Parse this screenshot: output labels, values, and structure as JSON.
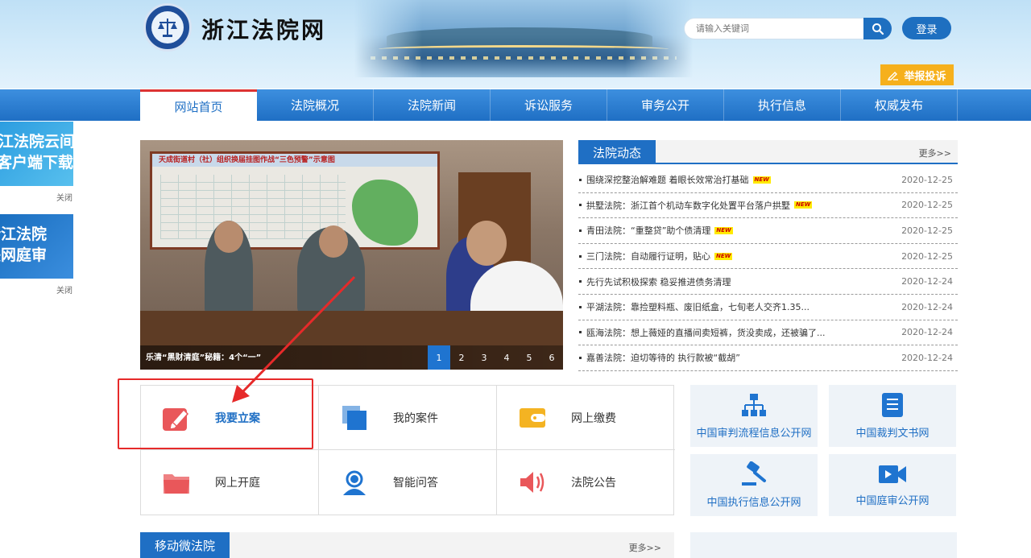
{
  "header": {
    "site_name": "浙江法院网",
    "search_placeholder": "请输入关键词",
    "login_label": "登录",
    "report_label": "举报投诉"
  },
  "nav": {
    "items": [
      {
        "label": "网站首页",
        "active": true
      },
      {
        "label": "法院概况"
      },
      {
        "label": "法院新闻"
      },
      {
        "label": "诉讼服务"
      },
      {
        "label": "审务公开"
      },
      {
        "label": "执行信息"
      },
      {
        "label": "权威发布"
      }
    ]
  },
  "side_ads": [
    {
      "line1": "江法院云间",
      "line2": "客户端下载",
      "close": "关闭"
    },
    {
      "line1": "浙江法院",
      "line2": "联网庭审",
      "close": "关闭"
    }
  ],
  "carousel": {
    "caption": "乐清“黑财清庭”秘籍：4个“一”",
    "board_title": "天成街道村（社）组织换届挂图作战“三色预警”示意图",
    "pages": [
      "1",
      "2",
      "3",
      "4",
      "5",
      "6"
    ],
    "active_page": 1
  },
  "news": {
    "title": "法院动态",
    "more": "更多>>",
    "new_badge": "NEW",
    "items": [
      {
        "title": "围绕深挖整治解难题 着眼长效常治打基础",
        "date": "2020-12-25",
        "new": true
      },
      {
        "title": "拱墅法院：浙江首个机动车数字化处置平台落户拱墅",
        "date": "2020-12-25",
        "new": true
      },
      {
        "title": "青田法院：“重整贷”助个债清理",
        "date": "2020-12-25",
        "new": true
      },
      {
        "title": "三门法院：自动履行证明，贴心",
        "date": "2020-12-25",
        "new": true
      },
      {
        "title": "先行先试积极探索 稳妥推进债务清理",
        "date": "2020-12-24",
        "new": false
      },
      {
        "title": "平湖法院：靠捡塑料瓶、废旧纸盒，七旬老人交齐1.35...",
        "date": "2020-12-24",
        "new": false
      },
      {
        "title": "瓯海法院：想上薇娅的直播间卖短裤，货没卖成，还被骗了...",
        "date": "2020-12-24",
        "new": false
      },
      {
        "title": "嘉善法院：迫切等待的 执行款被“截胡”",
        "date": "2020-12-24",
        "new": false
      }
    ]
  },
  "services": [
    {
      "label": "我要立案",
      "icon": "pencil-icon",
      "color": "#e9575a"
    },
    {
      "label": "我的案件",
      "icon": "stacked-squares-icon",
      "color": "#1f74d0"
    },
    {
      "label": "网上缴费",
      "icon": "wallet-icon",
      "color": "#f4b322"
    },
    {
      "label": "网上开庭",
      "icon": "folder-icon",
      "color": "#e9575a"
    },
    {
      "label": "智能问答",
      "icon": "support-agent-icon",
      "color": "#1f74d0"
    },
    {
      "label": "法院公告",
      "icon": "speaker-icon",
      "color": "#e9575a"
    }
  ],
  "links": [
    {
      "label": "中国审判流程信息公开网",
      "icon": "org-chart-icon"
    },
    {
      "label": "中国裁判文书网",
      "icon": "document-icon"
    },
    {
      "label": "中国执行信息公开网",
      "icon": "gavel-icon"
    },
    {
      "label": "中国庭审公开网",
      "icon": "video-camera-icon"
    }
  ],
  "bottom": {
    "title": "移动微法院",
    "more": "更多>>"
  },
  "colors": {
    "primary": "#1f6fc4",
    "accent_red": "#e62a2a",
    "report_orange": "#f6b01c"
  }
}
